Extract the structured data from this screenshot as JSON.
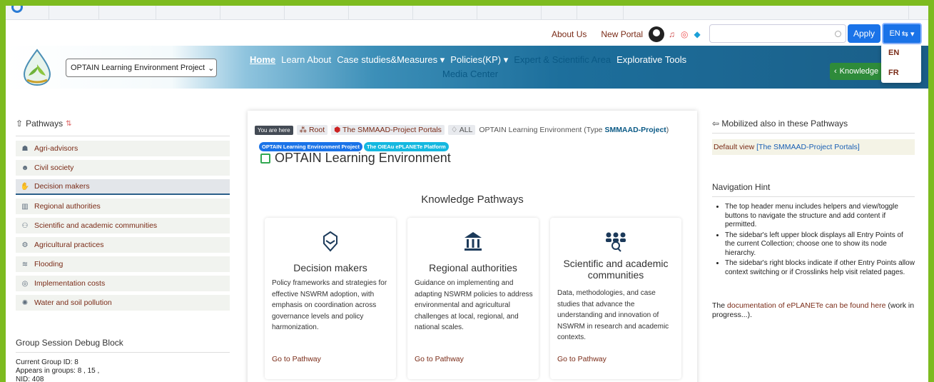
{
  "header": {
    "about": "About Us",
    "new_portal": "New Portal",
    "search_placeholder": "",
    "apply": "Apply",
    "lang_current": "EN",
    "lang_options": [
      "EN",
      "FR"
    ]
  },
  "banner": {
    "project_select": "OPTAIN Learning Environment Project",
    "nav": {
      "home": "Home",
      "learn": "Learn About",
      "cases": "Case studies&Measures",
      "policies": "Policies(KP)",
      "expert": "Expert & Scientific Area",
      "tools": "Explorative Tools",
      "media": "Media Center"
    },
    "knowledge_btn": "Knowledge"
  },
  "sidebar": {
    "title": "Pathways",
    "items": [
      {
        "label": "Agri-advisors",
        "icon": "farmer-icon"
      },
      {
        "label": "Civil society",
        "icon": "people-icon"
      },
      {
        "label": "Decision makers",
        "icon": "handshake-icon"
      },
      {
        "label": "Regional authorities",
        "icon": "institution-icon"
      },
      {
        "label": "Scientific and academic communities",
        "icon": "researchers-icon"
      },
      {
        "label": "Agricultural practices",
        "icon": "tractor-icon"
      },
      {
        "label": "Flooding",
        "icon": "flood-icon"
      },
      {
        "label": "Implementation costs",
        "icon": "coins-icon"
      },
      {
        "label": "Water and soil pollution",
        "icon": "pollution-icon"
      }
    ],
    "active_index": 2
  },
  "debug": {
    "title": "Group Session Debug Block",
    "lines": [
      "Current Group ID: 8",
      "Appears in groups: 8 , 15 ,",
      "NID: 408"
    ]
  },
  "main": {
    "crumbs": {
      "here": "You are here",
      "root": "Root",
      "portals": "The SMMAAD-Project Portals",
      "all": "ALL",
      "current": "OPTAIN Learning Environment (Type",
      "type": "SMMAAD-Project",
      "close": ")"
    },
    "tags": [
      "OPTAIN Learning Environment Project",
      "The OIEAu ePLANETe Platform"
    ],
    "title": "OPTAIN Learning Environment",
    "section": "Knowledge Pathways",
    "cards": [
      {
        "title": "Decision makers",
        "text": "Policy frameworks and strategies for effective NSWRM adoption, with emphasis on coordination across governance levels and policy harmonization.",
        "link": "Go to Pathway"
      },
      {
        "title": "Regional authorities",
        "text": "Guidance on implementing and adapting NSWRM policies to address environmental and agricultural challenges at local, regional, and national scales.",
        "link": "Go to Pathway"
      },
      {
        "title": "Scientific and academic communities",
        "text": "Data, methodologies, and case studies that advance the understanding and innovation of NSWRM in research and academic contexts.",
        "link": "Go to Pathway"
      }
    ]
  },
  "right": {
    "mobilized_title": "Mobilized also in these Pathways",
    "default_view": "Default view",
    "default_link": "[The SMMAAD-Project Portals]",
    "hint_title": "Navigation Hint",
    "hints": [
      "The top header menu includes helpers and view/toggle buttons to navigate the structure and add content if permitted.",
      "The sidebar's left upper block displays all Entry Points of the current Collection; choose one to show its node hierarchy.",
      "The sidebar's right blocks indicate if other Entry Points allow context switching or if Crosslinks help visit related pages."
    ],
    "doc_prefix": "The",
    "doc_link": "documentation of ePLANETe can be found here",
    "doc_suffix": "(work in progress...)."
  },
  "colors": {
    "border_green": "#7dbb1f",
    "link_brown": "#7a2b17",
    "primary_blue": "#1a73e8",
    "banner_blue": "#1a5e88"
  }
}
